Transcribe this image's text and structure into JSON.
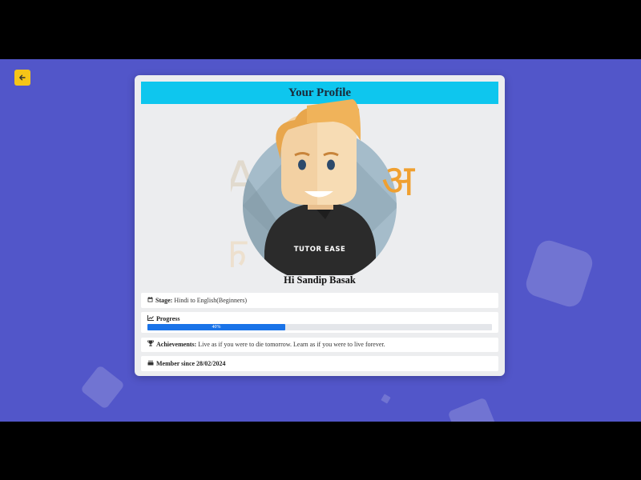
{
  "nav": {
    "back_icon": "arrow-left-icon"
  },
  "profile": {
    "title": "Your Profile",
    "avatar_shirt_text": "TUTOR EASE",
    "greeting": "Hi Sandip Basak",
    "stage": {
      "icon": "calendar-icon",
      "label": "Stage:",
      "value": "Hindi to English(Beginners)"
    },
    "progress": {
      "icon": "chart-line-icon",
      "label": "Progress",
      "percent": 40,
      "percent_label": "40%"
    },
    "achievements": {
      "icon": "trophy-icon",
      "label": "Achievements:",
      "value": "Live as if you were to die tomorrow. Learn as if you were to live forever."
    },
    "member": {
      "icon": "cake-icon",
      "label": "Member since 28/02/2024"
    }
  },
  "colors": {
    "background": "#5256c9",
    "header": "#0ec6ee",
    "back_button": "#f5c518",
    "progress_fill": "#1a73e8"
  }
}
